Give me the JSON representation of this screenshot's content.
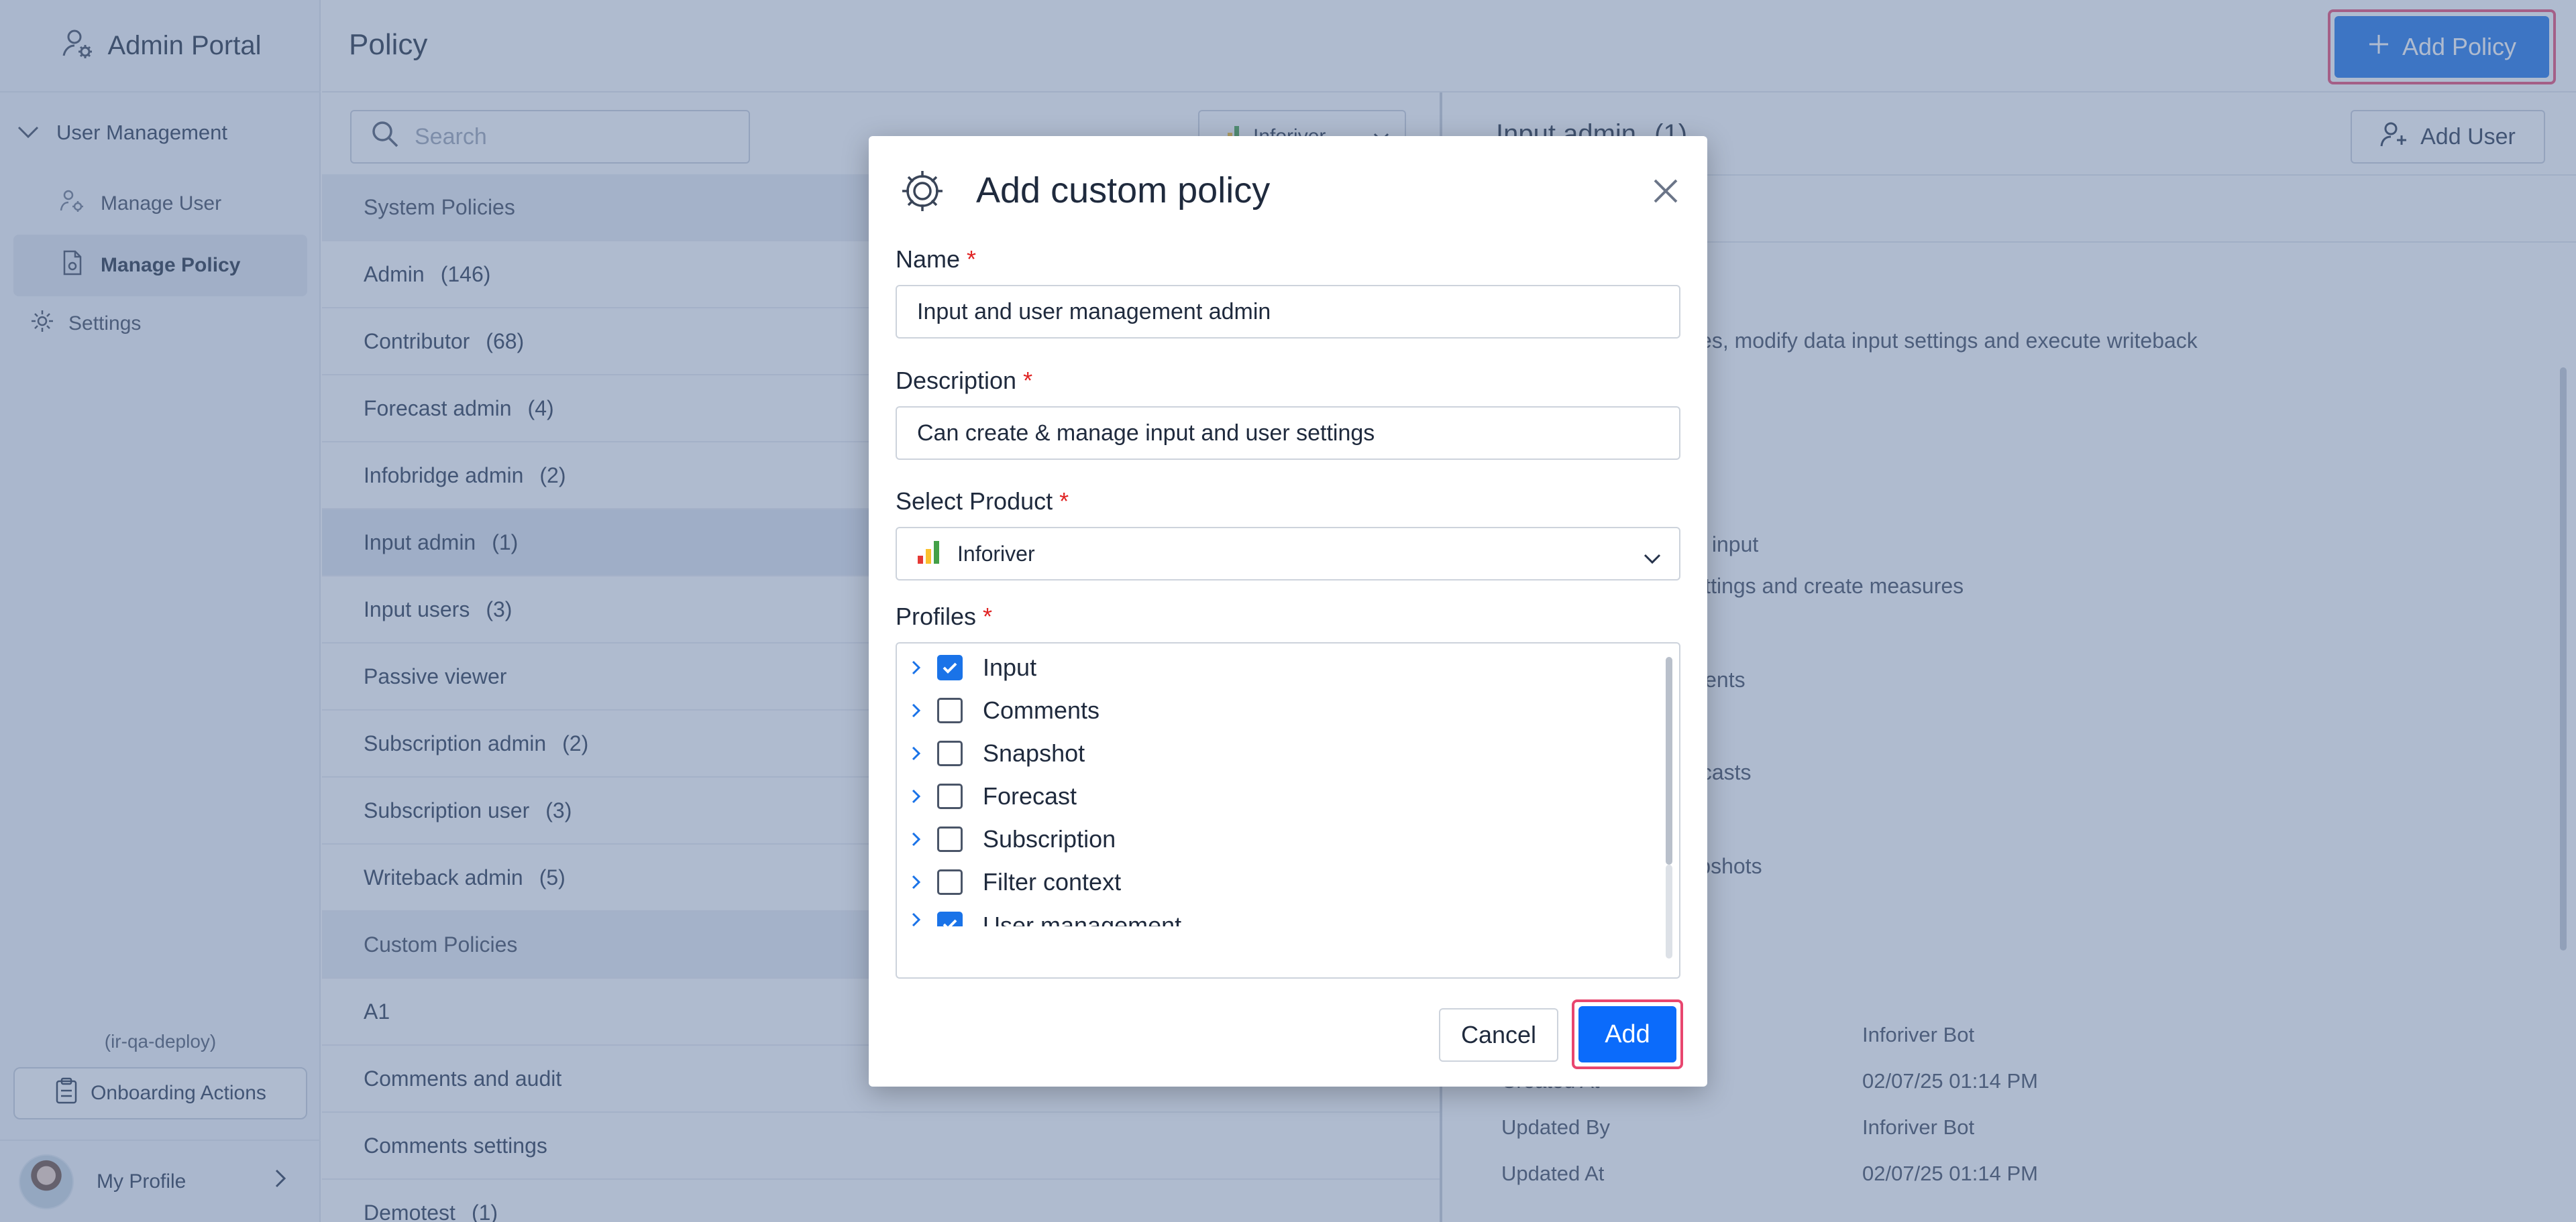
{
  "sidebar": {
    "brand": "Admin Portal",
    "group_label": "User Management",
    "items": [
      {
        "label": "Manage User"
      },
      {
        "label": "Manage Policy"
      }
    ],
    "settings_label": "Settings",
    "environment": "(ir-qa-deploy)",
    "onboarding_label": "Onboarding Actions",
    "profile_label": "My Profile"
  },
  "header": {
    "title": "Policy",
    "add_policy_label": "Add Policy"
  },
  "policy_list": {
    "search_placeholder": "Search",
    "product_filter": "Inforiver",
    "system_section": "System Policies",
    "system": [
      {
        "name": "Admin",
        "count": "(146)"
      },
      {
        "name": "Contributor",
        "count": "(68)"
      },
      {
        "name": "Forecast admin",
        "count": "(4)"
      },
      {
        "name": "Infobridge admin",
        "count": "(2)"
      },
      {
        "name": "Input admin",
        "count": "(1)"
      },
      {
        "name": "Input users",
        "count": "(3)"
      },
      {
        "name": "Passive viewer",
        "count": ""
      },
      {
        "name": "Subscription admin",
        "count": "(2)"
      },
      {
        "name": "Subscription user",
        "count": "(3)"
      },
      {
        "name": "Writeback admin",
        "count": "(5)"
      }
    ],
    "custom_section": "Custom Policies",
    "custom": [
      {
        "name": "A1",
        "count": ""
      },
      {
        "name": "Comments and audit",
        "count": ""
      },
      {
        "name": "Comments settings",
        "count": ""
      },
      {
        "name": "Demotest",
        "count": "(1)"
      }
    ]
  },
  "detail": {
    "title": "Input admin",
    "count": "(1)",
    "add_user_label": "Add User",
    "visible_text": [
      "easures, modify data input settings and execute writeback",
      "e data input",
      "out settings and create measures",
      "comments",
      "e forecasts",
      "e snapshots"
    ],
    "meta": [
      {
        "label": "",
        "value": "Inforiver Bot"
      },
      {
        "label": "Created At",
        "value": "02/07/25 01:14 PM"
      },
      {
        "label": "Updated By",
        "value": "Inforiver Bot"
      },
      {
        "label": "Updated At",
        "value": "02/07/25 01:14 PM"
      }
    ]
  },
  "modal": {
    "title": "Add custom policy",
    "name_label": "Name",
    "name_value": "Input and user management admin",
    "description_label": "Description",
    "description_value": "Can create & manage input and user settings",
    "product_label": "Select Product",
    "product_value": "Inforiver",
    "profiles_label": "Profiles",
    "required_mark": "*",
    "profiles": [
      {
        "label": "Input",
        "checked": true
      },
      {
        "label": "Comments",
        "checked": false
      },
      {
        "label": "Snapshot",
        "checked": false
      },
      {
        "label": "Forecast",
        "checked": false
      },
      {
        "label": "Subscription",
        "checked": false
      },
      {
        "label": "Filter context",
        "checked": false
      },
      {
        "label": "User management",
        "checked": true
      }
    ],
    "cancel_label": "Cancel",
    "add_label": "Add"
  },
  "colors": {
    "primary": "#1a73e8",
    "add_button": "#0b6bfb",
    "highlight_outline": "#e8466f",
    "required": "#e02424",
    "overlay": "rgba(95,120,160,0.5)"
  }
}
